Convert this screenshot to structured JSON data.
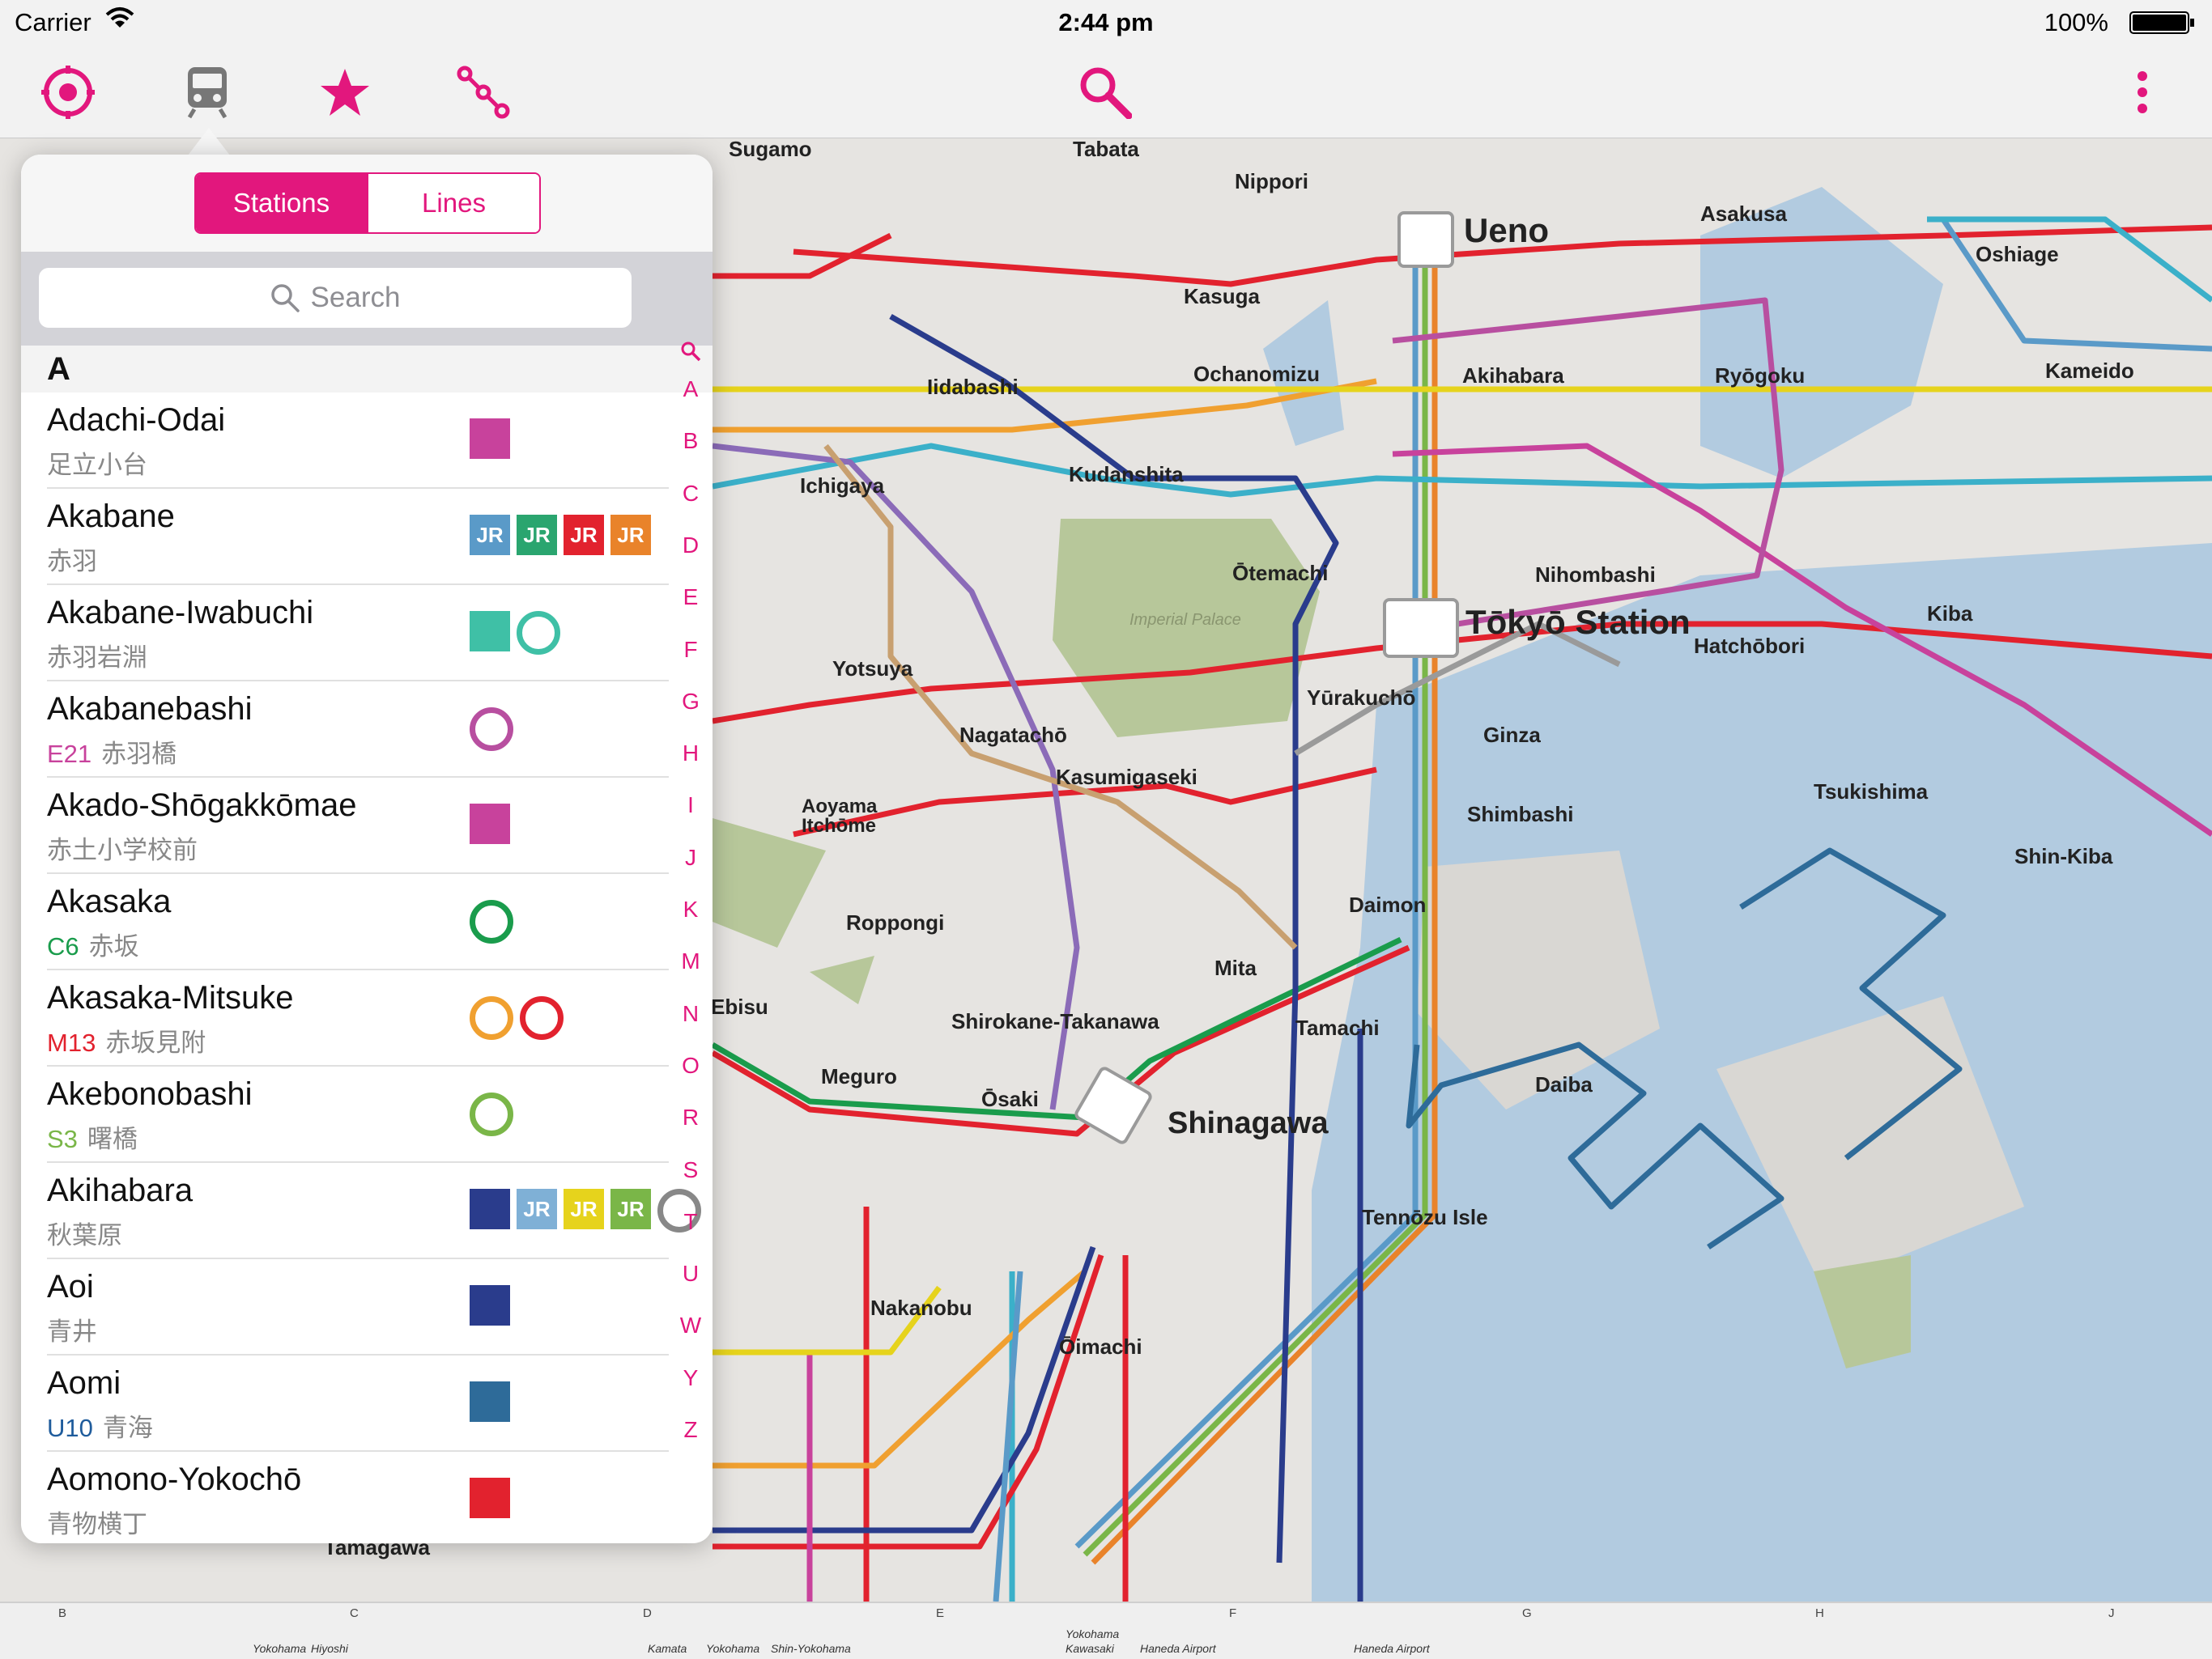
{
  "status_bar": {
    "carrier": "Carrier",
    "time": "2:44 pm",
    "battery": "100%"
  },
  "toolbar": {
    "icons": [
      "locate-icon",
      "train-icon",
      "star-icon",
      "route-icon",
      "search-icon",
      "more-icon"
    ],
    "accent": "#e2177d"
  },
  "popover": {
    "segment": {
      "stations": "Stations",
      "lines": "Lines",
      "selected": "Stations"
    },
    "search_placeholder": "Search",
    "section": "A",
    "rows": [
      {
        "name": "Adachi-Odai",
        "code": "",
        "kanji": "足立小台",
        "code_color": "",
        "badges": [
          {
            "t": "sq",
            "c": "#c8429c"
          }
        ]
      },
      {
        "name": "Akabane",
        "code": "",
        "kanji": "赤羽",
        "code_color": "",
        "badges": [
          {
            "t": "jr",
            "c": "#5a9ac8",
            "l": "JR"
          },
          {
            "t": "jr",
            "c": "#2aa56f",
            "l": "JR"
          },
          {
            "t": "jr",
            "c": "#e2222e",
            "l": "JR"
          },
          {
            "t": "jr",
            "c": "#e9832a",
            "l": "JR"
          }
        ]
      },
      {
        "name": "Akabane-Iwabuchi",
        "code": "",
        "kanji": "赤羽岩淵",
        "code_color": "",
        "badges": [
          {
            "t": "sq",
            "c": "#3fc0a6"
          },
          {
            "t": "ring",
            "c": "#3fc0a6"
          }
        ]
      },
      {
        "name": "Akabanebashi",
        "code": "E21",
        "kanji": "赤羽橋",
        "code_color": "#c8429c",
        "badges": [
          {
            "t": "ring",
            "c": "#b84fa0"
          }
        ]
      },
      {
        "name": "Akado-Shōgakkōmae",
        "code": "",
        "kanji": "赤土小学校前",
        "code_color": "",
        "badges": [
          {
            "t": "sq",
            "c": "#c8429c"
          }
        ]
      },
      {
        "name": "Akasaka",
        "code": "C6",
        "kanji": "赤坂",
        "code_color": "#1a9c4c",
        "badges": [
          {
            "t": "ring",
            "c": "#1a9c4c"
          }
        ]
      },
      {
        "name": "Akasaka-Mitsuke",
        "code": "M13",
        "kanji": "赤坂見附",
        "code_color": "#e2222e",
        "badges": [
          {
            "t": "ring",
            "c": "#f0a030"
          },
          {
            "t": "ring",
            "c": "#e2222e"
          }
        ]
      },
      {
        "name": "Akebonobashi",
        "code": "S3",
        "kanji": "曙橋",
        "code_color": "#7ab648",
        "badges": [
          {
            "t": "ring",
            "c": "#7ab648"
          }
        ]
      },
      {
        "name": "Akihabara",
        "code": "",
        "kanji": "秋葉原",
        "code_color": "",
        "badges": [
          {
            "t": "sq",
            "c": "#2a3c8c"
          },
          {
            "t": "jr",
            "c": "#7fb0d6",
            "l": "JR"
          },
          {
            "t": "jr",
            "c": "#e6d31c",
            "l": "JR"
          },
          {
            "t": "jr",
            "c": "#7ab648",
            "l": "JR"
          },
          {
            "t": "ring",
            "c": "#888888"
          }
        ]
      },
      {
        "name": "Aoi",
        "code": "",
        "kanji": "青井",
        "code_color": "",
        "badges": [
          {
            "t": "sq",
            "c": "#2a3c8c"
          }
        ]
      },
      {
        "name": "Aomi",
        "code": "U10",
        "kanji": "青海",
        "code_color": "#1f5c9c",
        "badges": [
          {
            "t": "sq",
            "c": "#2e6b99"
          }
        ]
      },
      {
        "name": "Aomono-Yokochō",
        "code": "",
        "kanji": "青物横丁",
        "code_color": "",
        "badges": [
          {
            "t": "sq",
            "c": "#e2222e"
          }
        ]
      }
    ],
    "index": [
      "A",
      "B",
      "C",
      "D",
      "E",
      "F",
      "G",
      "H",
      "I",
      "J",
      "K",
      "M",
      "N",
      "O",
      "R",
      "S",
      "T",
      "U",
      "W",
      "Y",
      "Z"
    ]
  },
  "map": {
    "stations_major": [
      "Ueno",
      "Tōkyō Station",
      "Shinagawa"
    ],
    "stations": [
      "Sugamo",
      "Tabata",
      "Nippori",
      "Asakusa",
      "Oshiage",
      "Kasuga",
      "Akihabara",
      "Ryōgoku",
      "Kameido",
      "Iidabashi",
      "Ochanomizu",
      "Ichigaya",
      "Kudanshita",
      "Ōtemachi",
      "Nihombashi",
      "Kiba",
      "Yotsuya",
      "Hatchōbori",
      "Yūrakuchō",
      "Nagatachō",
      "Ginza",
      "Tsukishima",
      "Kasumigaseki",
      "Shimbashi",
      "Shin-Kiba",
      "Aoyama Itchōme",
      "Roppongi",
      "Daimon",
      "Mita",
      "Ebisu",
      "Shirokane-Takanawa",
      "Tamachi",
      "Meguro",
      "Ōsaki",
      "Daiba",
      "Tennōzu Isle",
      "Nakanobu",
      "Ōimachi",
      "Tamagawa"
    ],
    "labels_small": [
      "Imperial Palace"
    ]
  },
  "ruler": {
    "cols": [
      "B",
      "C",
      "D",
      "E",
      "F",
      "G",
      "H",
      "J"
    ],
    "bottom": [
      "Yokohama",
      "Hiyoshi",
      "Kamata",
      "Yokohama",
      "Shin-Yokohama",
      "Kawasaki",
      "Yokohama",
      "Haneda Airport",
      "Haneda Airport"
    ]
  }
}
